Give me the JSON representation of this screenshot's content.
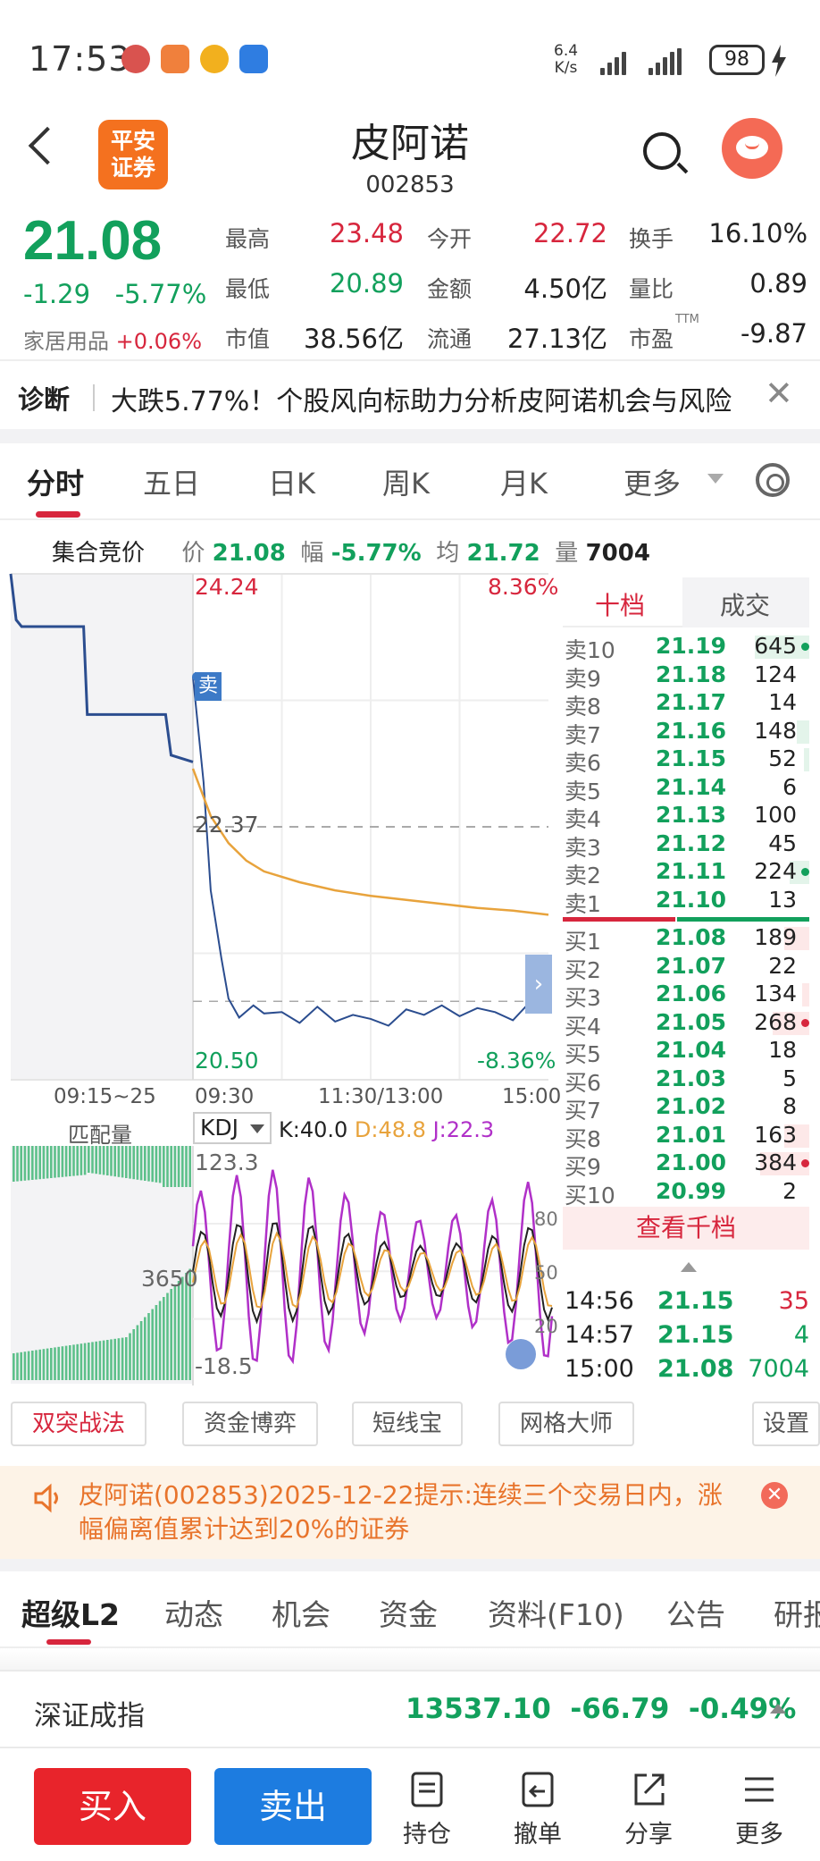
{
  "status_bar": {
    "time": "17:53",
    "network_speed_value": "6.4",
    "network_speed_unit": "K/s",
    "battery": "98"
  },
  "header": {
    "broker_logo_line1": "平安",
    "broker_logo_line2": "证券",
    "stock_name": "皮阿诺",
    "stock_code": "002853"
  },
  "quote": {
    "price": "21.08",
    "change": "-1.29",
    "change_pct": "-5.77%",
    "sector_name": "家居用品",
    "sector_change": "+0.06%",
    "fields": [
      {
        "label": "最高",
        "value": "23.48",
        "color": "red"
      },
      {
        "label": "今开",
        "value": "22.72",
        "color": "red"
      },
      {
        "label": "换手",
        "value": "16.10%",
        "color": "dark"
      },
      {
        "label": "最低",
        "value": "20.89",
        "color": "green"
      },
      {
        "label": "金额",
        "value": "4.50亿",
        "color": "dark"
      },
      {
        "label": "量比",
        "value": "0.89",
        "color": "dark"
      },
      {
        "label": "市值",
        "value": "38.56亿",
        "color": "dark"
      },
      {
        "label": "流通",
        "value": "27.13亿",
        "color": "dark"
      },
      {
        "label": "市盈",
        "value": "-9.87",
        "color": "dark",
        "label_sup": "TTM"
      }
    ]
  },
  "diagnosis": {
    "title": "诊断",
    "text": "大跌5.77%！个股风向标助力分析皮阿诺机会与风险"
  },
  "chart_tabs": [
    "分时",
    "五日",
    "日K",
    "周K",
    "月K",
    "更多"
  ],
  "info_line": {
    "auction_label": "集合竞价",
    "price_label": "价",
    "price": "21.08",
    "range_label": "幅",
    "range": "-5.77%",
    "avg_label": "均",
    "avg": "21.72",
    "volume_label": "量",
    "volume": "7004"
  },
  "chart_axes": {
    "top_price": "24.24",
    "top_pct": "8.36%",
    "mid_price": "22.37",
    "bottom_price": "20.50",
    "bottom_pct": "-8.36%",
    "sell_marker": "卖",
    "time_labels": [
      "09:15~25",
      "09:30",
      "11:30/13:00",
      "15:00"
    ]
  },
  "chart_data": {
    "type": "line",
    "title": "",
    "ylim": [
      20.5,
      24.24
    ],
    "reference_price": 22.37,
    "x_range": [
      "09:30",
      "15:00"
    ],
    "series": [
      {
        "role": "price",
        "color": "#2b4d8f",
        "x_frac": [
          0,
          0.03,
          0.05,
          0.08,
          0.1,
          0.13,
          0.17,
          0.2,
          0.25,
          0.3,
          0.35,
          0.4,
          0.45,
          0.5,
          0.55,
          0.6,
          0.65,
          0.7,
          0.75,
          0.8,
          0.85,
          0.9,
          0.95,
          1.0
        ],
        "values": [
          23.48,
          22.7,
          21.9,
          21.4,
          21.1,
          20.96,
          21.05,
          20.99,
          21.0,
          20.92,
          21.04,
          20.93,
          20.98,
          20.95,
          20.9,
          21.02,
          20.98,
          21.05,
          20.97,
          21.03,
          21.0,
          20.94,
          21.08,
          21.08
        ]
      },
      {
        "role": "average",
        "color": "#e8a33c",
        "x_frac": [
          0,
          0.05,
          0.1,
          0.15,
          0.2,
          0.3,
          0.4,
          0.5,
          0.6,
          0.7,
          0.8,
          0.9,
          1.0
        ],
        "values": [
          22.8,
          22.45,
          22.25,
          22.12,
          22.04,
          21.96,
          21.9,
          21.86,
          21.83,
          21.8,
          21.77,
          21.75,
          21.72
        ]
      }
    ],
    "auction_series": {
      "color": "#2b4d8f",
      "x_frac": [
        0,
        0.03,
        0.06,
        0.4,
        0.42,
        0.55,
        0.85,
        0.88,
        1.0
      ],
      "values": [
        24.24,
        23.9,
        23.85,
        23.85,
        23.2,
        23.2,
        23.2,
        22.9,
        22.85
      ]
    }
  },
  "order_book": {
    "tab_levels": "十档",
    "tab_trades": "成交",
    "asks": [
      {
        "label": "卖10",
        "price": "21.19",
        "volume": "645",
        "dot": true,
        "bar_frac": 0.22
      },
      {
        "label": "卖9",
        "price": "21.18",
        "volume": "124",
        "dot": false,
        "bar_frac": 0.0
      },
      {
        "label": "卖8",
        "price": "21.17",
        "volume": "14",
        "dot": false,
        "bar_frac": 0.0
      },
      {
        "label": "卖7",
        "price": "21.16",
        "volume": "148",
        "dot": false,
        "bar_frac": 0.05
      },
      {
        "label": "卖6",
        "price": "21.15",
        "volume": "52",
        "dot": false,
        "bar_frac": 0.02
      },
      {
        "label": "卖5",
        "price": "21.14",
        "volume": "6",
        "dot": false,
        "bar_frac": 0.0
      },
      {
        "label": "卖4",
        "price": "21.13",
        "volume": "100",
        "dot": false,
        "bar_frac": 0.0
      },
      {
        "label": "卖3",
        "price": "21.12",
        "volume": "45",
        "dot": false,
        "bar_frac": 0.0
      },
      {
        "label": "卖2",
        "price": "21.11",
        "volume": "224",
        "dot": true,
        "bar_frac": 0.08
      },
      {
        "label": "卖1",
        "price": "21.10",
        "volume": "13",
        "dot": false,
        "bar_frac": 0.0
      }
    ],
    "bids": [
      {
        "label": "买1",
        "price": "21.08",
        "volume": "189",
        "dot": false,
        "bar_frac": 0.1
      },
      {
        "label": "买2",
        "price": "21.07",
        "volume": "22",
        "dot": false,
        "bar_frac": 0.0
      },
      {
        "label": "买3",
        "price": "21.06",
        "volume": "134",
        "dot": false,
        "bar_frac": 0.03
      },
      {
        "label": "买4",
        "price": "21.05",
        "volume": "268",
        "dot": true,
        "bar_frac": 0.15
      },
      {
        "label": "买5",
        "price": "21.04",
        "volume": "18",
        "dot": false,
        "bar_frac": 0.0
      },
      {
        "label": "买6",
        "price": "21.03",
        "volume": "5",
        "dot": false,
        "bar_frac": 0.0
      },
      {
        "label": "买7",
        "price": "21.02",
        "volume": "8",
        "dot": false,
        "bar_frac": 0.0
      },
      {
        "label": "买8",
        "price": "21.01",
        "volume": "163",
        "dot": false,
        "bar_frac": 0.1
      },
      {
        "label": "买9",
        "price": "21.00",
        "volume": "384",
        "dot": true,
        "bar_frac": 0.2
      },
      {
        "label": "买10",
        "price": "20.99",
        "volume": "2",
        "dot": false,
        "bar_frac": 0.0
      }
    ],
    "view_more": "查看千档"
  },
  "ticks": [
    {
      "time": "14:56",
      "price": "21.15",
      "volume": "35",
      "vol_color": "red"
    },
    {
      "time": "14:57",
      "price": "21.15",
      "volume": "4",
      "vol_color": "green"
    },
    {
      "time": "15:00",
      "price": "21.08",
      "volume": "7004",
      "vol_color": "green"
    }
  ],
  "kdj": {
    "match_volume_label": "匹配量",
    "indicator": "KDJ",
    "k_label": "K:40.0",
    "d_label": "D:48.8",
    "j_label": "J:22.3",
    "top_value": "123.3",
    "mid_value": "3650",
    "bottom_value": "-18.5",
    "level_80": "80",
    "level_50": "50",
    "level_20": "20",
    "k_color": "#222222",
    "d_color": "#e8a33c",
    "j_color": "#b030c8"
  },
  "tools": [
    "双突战法",
    "资金博弈",
    "短线宝",
    "网格大师",
    "设置"
  ],
  "notice": {
    "text": "皮阿诺(002853)2025-12-22提示:连续三个交易日内，涨幅偏离值累计达到20%的证券"
  },
  "lower_tabs": [
    "超级L2",
    "动态",
    "机会",
    "资金",
    "资料(F10)",
    "公告",
    "研报"
  ],
  "index_bar": {
    "name": "深证成指",
    "value": "13537.10",
    "change": "-66.79",
    "change_pct": "-0.49%"
  },
  "bottom_nav": {
    "buy": "买入",
    "sell": "卖出",
    "items": [
      {
        "label": "持仓",
        "icon": "positions-icon"
      },
      {
        "label": "撤单",
        "icon": "cancel-order-icon"
      },
      {
        "label": "分享",
        "icon": "share-icon"
      },
      {
        "label": "更多",
        "icon": "menu-icon"
      }
    ]
  },
  "colors": {
    "red": "#d7263d",
    "green": "#12a05c",
    "brand_orange": "#f4711f",
    "sell_blue": "#1d7ce0",
    "buy_red": "#e8242b"
  }
}
